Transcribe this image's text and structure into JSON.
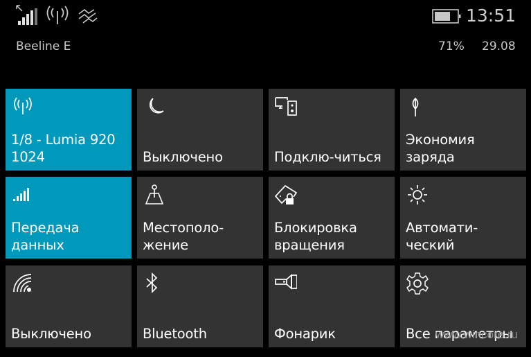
{
  "status_bar": {
    "icons": [
      "signal-strength-icon",
      "roaming-arrow-icon",
      "hotspot-icon",
      "vibrate-icon",
      "battery-icon"
    ],
    "carrier": "Beeline E",
    "time": "13:51",
    "battery_percent": "71%",
    "battery_level": 0.71,
    "date": "29.08"
  },
  "tiles": [
    {
      "icon": "hotspot-icon",
      "label": "1/8 - Lumia 920\n1024",
      "active": true
    },
    {
      "icon": "moon-icon",
      "label": "Выключено",
      "active": false
    },
    {
      "icon": "project-screen-icon",
      "label": "Подклю-читься",
      "active": false
    },
    {
      "icon": "battery-saver-leaf-icon",
      "label": "Экономия\nзаряда",
      "active": false
    },
    {
      "icon": "cellular-data-icon",
      "label": "Передача\nданных",
      "active": true
    },
    {
      "icon": "location-icon",
      "label": "Местополо-\nжение",
      "active": false
    },
    {
      "icon": "rotation-lock-icon",
      "label": "Блокировка\nвращения",
      "active": false
    },
    {
      "icon": "brightness-icon",
      "label": "Автомати-\nческий",
      "active": false
    },
    {
      "icon": "wifi-icon",
      "label": "Выключено",
      "active": false
    },
    {
      "icon": "bluetooth-icon",
      "label": "Bluetooth",
      "active": false
    },
    {
      "icon": "flashlight-icon",
      "label": "Фонарик",
      "active": false
    },
    {
      "icon": "settings-gear-icon",
      "label": "Все параметры",
      "active": false
    }
  ],
  "colors": {
    "accent": "#0099bc",
    "tile_off": "#333333",
    "background": "#000000"
  },
  "watermark": "www.wincore.ru"
}
